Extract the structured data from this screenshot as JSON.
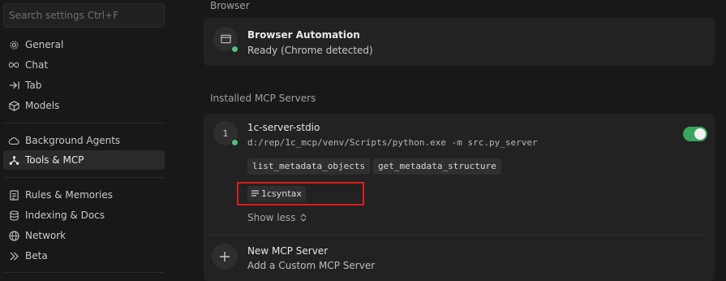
{
  "search": {
    "placeholder": "Search settings Ctrl+F"
  },
  "sidebar": {
    "items": [
      {
        "label": "General",
        "icon": "gear-icon"
      },
      {
        "label": "Chat",
        "icon": "infinity-icon"
      },
      {
        "label": "Tab",
        "icon": "tab-arrow-icon"
      },
      {
        "label": "Models",
        "icon": "cube-icon"
      },
      {
        "label": "Background Agents",
        "icon": "cloud-icon"
      },
      {
        "label": "Tools & MCP",
        "icon": "tools-icon"
      },
      {
        "label": "Rules & Memories",
        "icon": "document-icon"
      },
      {
        "label": "Indexing & Docs",
        "icon": "database-icon"
      },
      {
        "label": "Network",
        "icon": "globe-icon"
      },
      {
        "label": "Beta",
        "icon": "chevrons-icon"
      }
    ],
    "active": "Tools & MCP"
  },
  "browser": {
    "section_title": "Browser",
    "name": "Browser Automation",
    "status": "Ready (Chrome detected)"
  },
  "mcp": {
    "section_title": "Installed MCP Servers",
    "server": {
      "index": "1",
      "name": "1c-server-stdio",
      "command": "d:/rep/1c_mcp/venv/Scripts/python.exe -m src.py_server",
      "tools": [
        "list_metadata_objects",
        "get_metadata_structure"
      ],
      "resource": "1csyntax",
      "toggle_on": true,
      "show_less": "Show less"
    },
    "new_server": {
      "title": "New MCP Server",
      "subtitle": "Add a Custom MCP Server"
    }
  },
  "colors": {
    "accent_green": "#3ba55c",
    "highlight_red": "#e11b1b",
    "status_dot": "#4ec27b"
  }
}
